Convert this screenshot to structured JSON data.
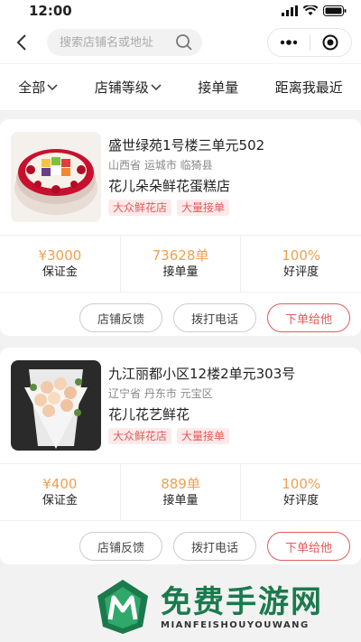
{
  "status_bar": {
    "time": "12:00"
  },
  "search": {
    "placeholder": "搜索店铺名或地址"
  },
  "filters": [
    {
      "label": "全部",
      "dropdown": true
    },
    {
      "label": "店铺等级",
      "dropdown": true
    },
    {
      "label": "接单量",
      "dropdown": false
    },
    {
      "label": "距离我最近",
      "dropdown": false
    }
  ],
  "stores": [
    {
      "address": "盛世绿苑1号楼三单元502",
      "region": "山西省 运城市 临猗县",
      "name": "花儿朵朵鲜花蛋糕店",
      "tags": [
        "大众鲜花店",
        "大量接单"
      ],
      "stats": [
        {
          "value": "¥3000",
          "label": "保证金"
        },
        {
          "value": "73628单",
          "label": "接单量"
        },
        {
          "value": "100%",
          "label": "好评度"
        }
      ],
      "actions": [
        "店铺反馈",
        "拨打电话",
        "下单给他"
      ],
      "image": "cake"
    },
    {
      "address": "九江丽都小区12楼2单元303号",
      "region": "辽宁省 丹东市 元宝区",
      "name": "花儿花艺鲜花",
      "tags": [
        "大众鲜花店",
        "大量接单"
      ],
      "stats": [
        {
          "value": "¥400",
          "label": "保证金"
        },
        {
          "value": "889单",
          "label": "接单量"
        },
        {
          "value": "100%",
          "label": "好评度"
        }
      ],
      "actions": [
        "店铺反馈",
        "拨打电话",
        "下单给他"
      ],
      "image": "bouquet"
    }
  ],
  "watermark": {
    "title": "免费手游网",
    "subtitle": "MIANFEISHOUYOUWANG"
  },
  "colors": {
    "accent": "#e35a5a",
    "stat_value": "#f0a050",
    "watermark_green": "#1a7a4c"
  }
}
